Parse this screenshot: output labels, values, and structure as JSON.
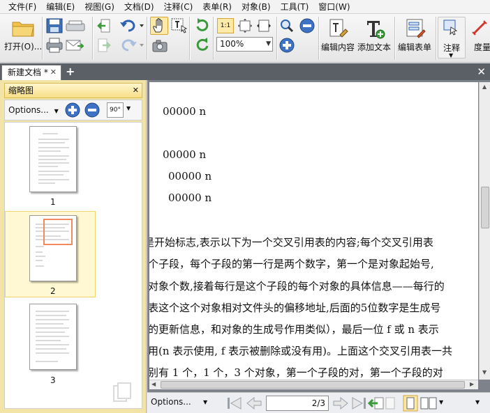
{
  "menu": [
    "文件(F)",
    "编辑(E)",
    "视图(G)",
    "文档(D)",
    "注释(C)",
    "表单(R)",
    "对象(B)",
    "工具(T)",
    "窗口(W)"
  ],
  "toolbar": {
    "open_label": "打开(O)...",
    "zoom_value": "100%",
    "edit_content_label": "编辑内容",
    "add_text_label": "添加文本",
    "edit_form_label": "编辑表单",
    "annotate_label": "注释",
    "measure_label": "度量"
  },
  "tabs": {
    "active_label": "新建文档 *"
  },
  "thumbnails": {
    "title": "缩略图",
    "options_label": "Options...",
    "rotate_label": "90°",
    "pages": [
      "1",
      "2",
      "3"
    ],
    "selected_page": "2"
  },
  "document": {
    "lines": [
      "00000      n",
      "00000      n",
      "00000      n",
      "00000      n",
      "是开始标志,表示以下为一个交叉引用表的内容;每个交叉引用表",
      "个子段，每个子段的第一行是两个数字，第一个是对象起始号,",
      "对象个数,接着每行是这个子段的每个对象的具体信息——每行的",
      "表这个这个对象相对文件头的偏移地址,后面的5位数字是生成号",
      "的更新信息，和对象的生成号作用类似），最后一位 f 或 n 表示",
      "用(n 表示使用, f 表示被删除或没有用)。上面这个交叉引用表一共",
      "别有 1 个，1 个，3 个对象，第一个子段的对，第一个子段的对"
    ]
  },
  "status": {
    "options_label": "Options...",
    "page_indicator": "2/3"
  },
  "colors": {
    "panel_bg": "#f2e3a6",
    "selection_border": "#f3d56b",
    "thumb_highlight": "#f08a5d",
    "tab_bar": "#5b5f66"
  }
}
